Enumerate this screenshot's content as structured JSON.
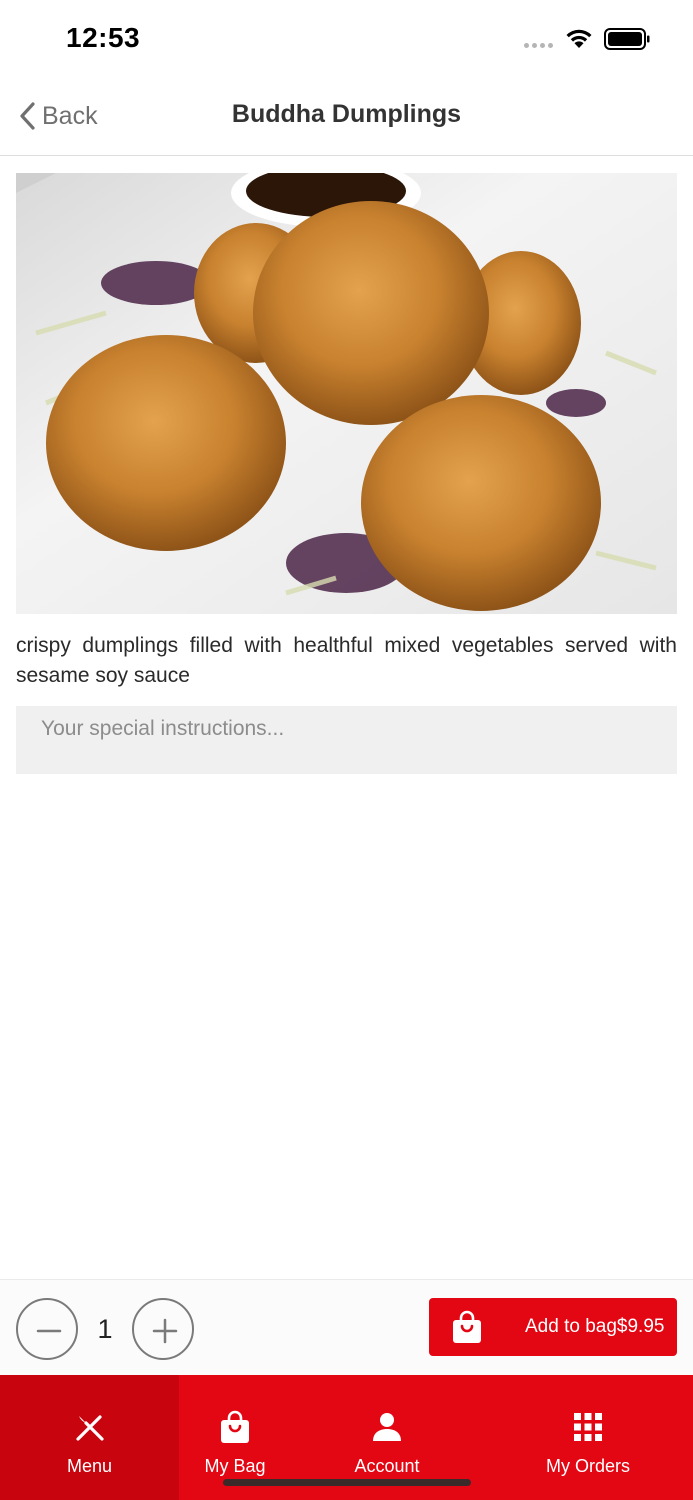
{
  "status_bar": {
    "time": "12:53"
  },
  "nav": {
    "back_label": "Back",
    "title": "Buddha Dumplings"
  },
  "item": {
    "image_alt": "Buddha Dumplings",
    "description": "crispy dumplings filled with healthful mixed vegetables served with sesame soy sauce",
    "instructions_placeholder": "Your special instructions...",
    "instructions_value": ""
  },
  "order": {
    "quantity": "1",
    "add_label": "Add to bag",
    "price": "$9.95"
  },
  "tabs": [
    {
      "label": "Menu",
      "icon": "fork-knife-icon",
      "active": true
    },
    {
      "label": "My Bag",
      "icon": "shopping-bag-icon",
      "active": false
    },
    {
      "label": "Account",
      "icon": "person-icon",
      "active": false
    },
    {
      "label": "My Orders",
      "icon": "grid-icon",
      "active": false
    }
  ],
  "colors": {
    "accent": "#e30613",
    "accent_active": "#c8050f"
  }
}
